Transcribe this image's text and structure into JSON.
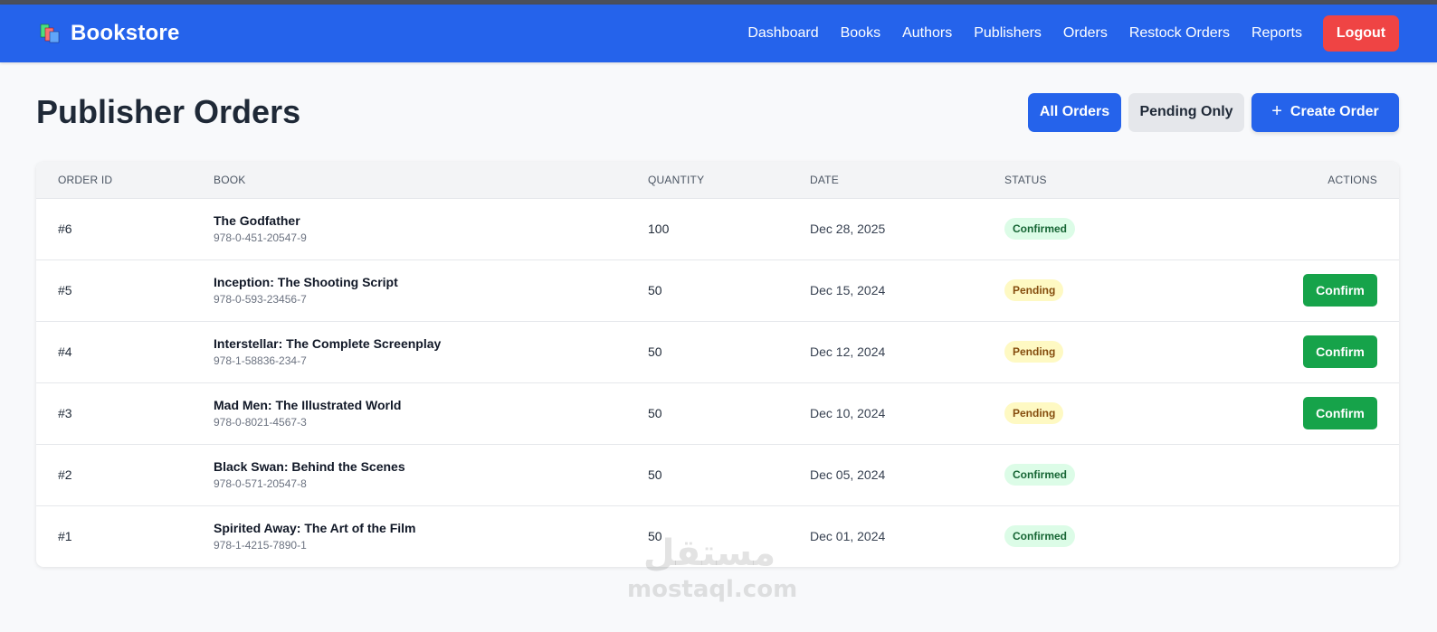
{
  "brand": {
    "title": "Bookstore"
  },
  "nav": {
    "links": [
      "Dashboard",
      "Books",
      "Authors",
      "Publishers",
      "Orders",
      "Restock Orders",
      "Reports"
    ],
    "logout_label": "Logout"
  },
  "page": {
    "title": "Publisher Orders",
    "filter_all_label": "All Orders",
    "filter_pending_label": "Pending Only",
    "create_label": "Create Order",
    "create_icon": "plus-icon"
  },
  "table": {
    "headers": {
      "order_id": "ORDER ID",
      "book": "BOOK",
      "quantity": "QUANTITY",
      "date": "DATE",
      "status": "STATUS",
      "actions": "ACTIONS"
    },
    "confirm_label": "Confirm",
    "rows": [
      {
        "id": "#6",
        "title": "The Godfather",
        "isbn": "978-0-451-20547-9",
        "quantity": "100",
        "date": "Dec 28, 2025",
        "status": "Confirmed",
        "pending": false
      },
      {
        "id": "#5",
        "title": "Inception: The Shooting Script",
        "isbn": "978-0-593-23456-7",
        "quantity": "50",
        "date": "Dec 15, 2024",
        "status": "Pending",
        "pending": true
      },
      {
        "id": "#4",
        "title": "Interstellar: The Complete Screenplay",
        "isbn": "978-1-58836-234-7",
        "quantity": "50",
        "date": "Dec 12, 2024",
        "status": "Pending",
        "pending": true
      },
      {
        "id": "#3",
        "title": "Mad Men: The Illustrated World",
        "isbn": "978-0-8021-4567-3",
        "quantity": "50",
        "date": "Dec 10, 2024",
        "status": "Pending",
        "pending": true
      },
      {
        "id": "#2",
        "title": "Black Swan: Behind the Scenes",
        "isbn": "978-0-571-20547-8",
        "quantity": "50",
        "date": "Dec 05, 2024",
        "status": "Confirmed",
        "pending": false
      },
      {
        "id": "#1",
        "title": "Spirited Away: The Art of the Film",
        "isbn": "978-1-4215-7890-1",
        "quantity": "50",
        "date": "Dec 01, 2024",
        "status": "Confirmed",
        "pending": false
      }
    ]
  },
  "watermark": {
    "arabic": "مستقل",
    "latin": "mostaql.com"
  },
  "colors": {
    "primary": "#2563eb",
    "danger": "#ef4444",
    "success": "#16a34a",
    "confirmed_bg": "#dcfce7",
    "pending_bg": "#fef9c3"
  }
}
